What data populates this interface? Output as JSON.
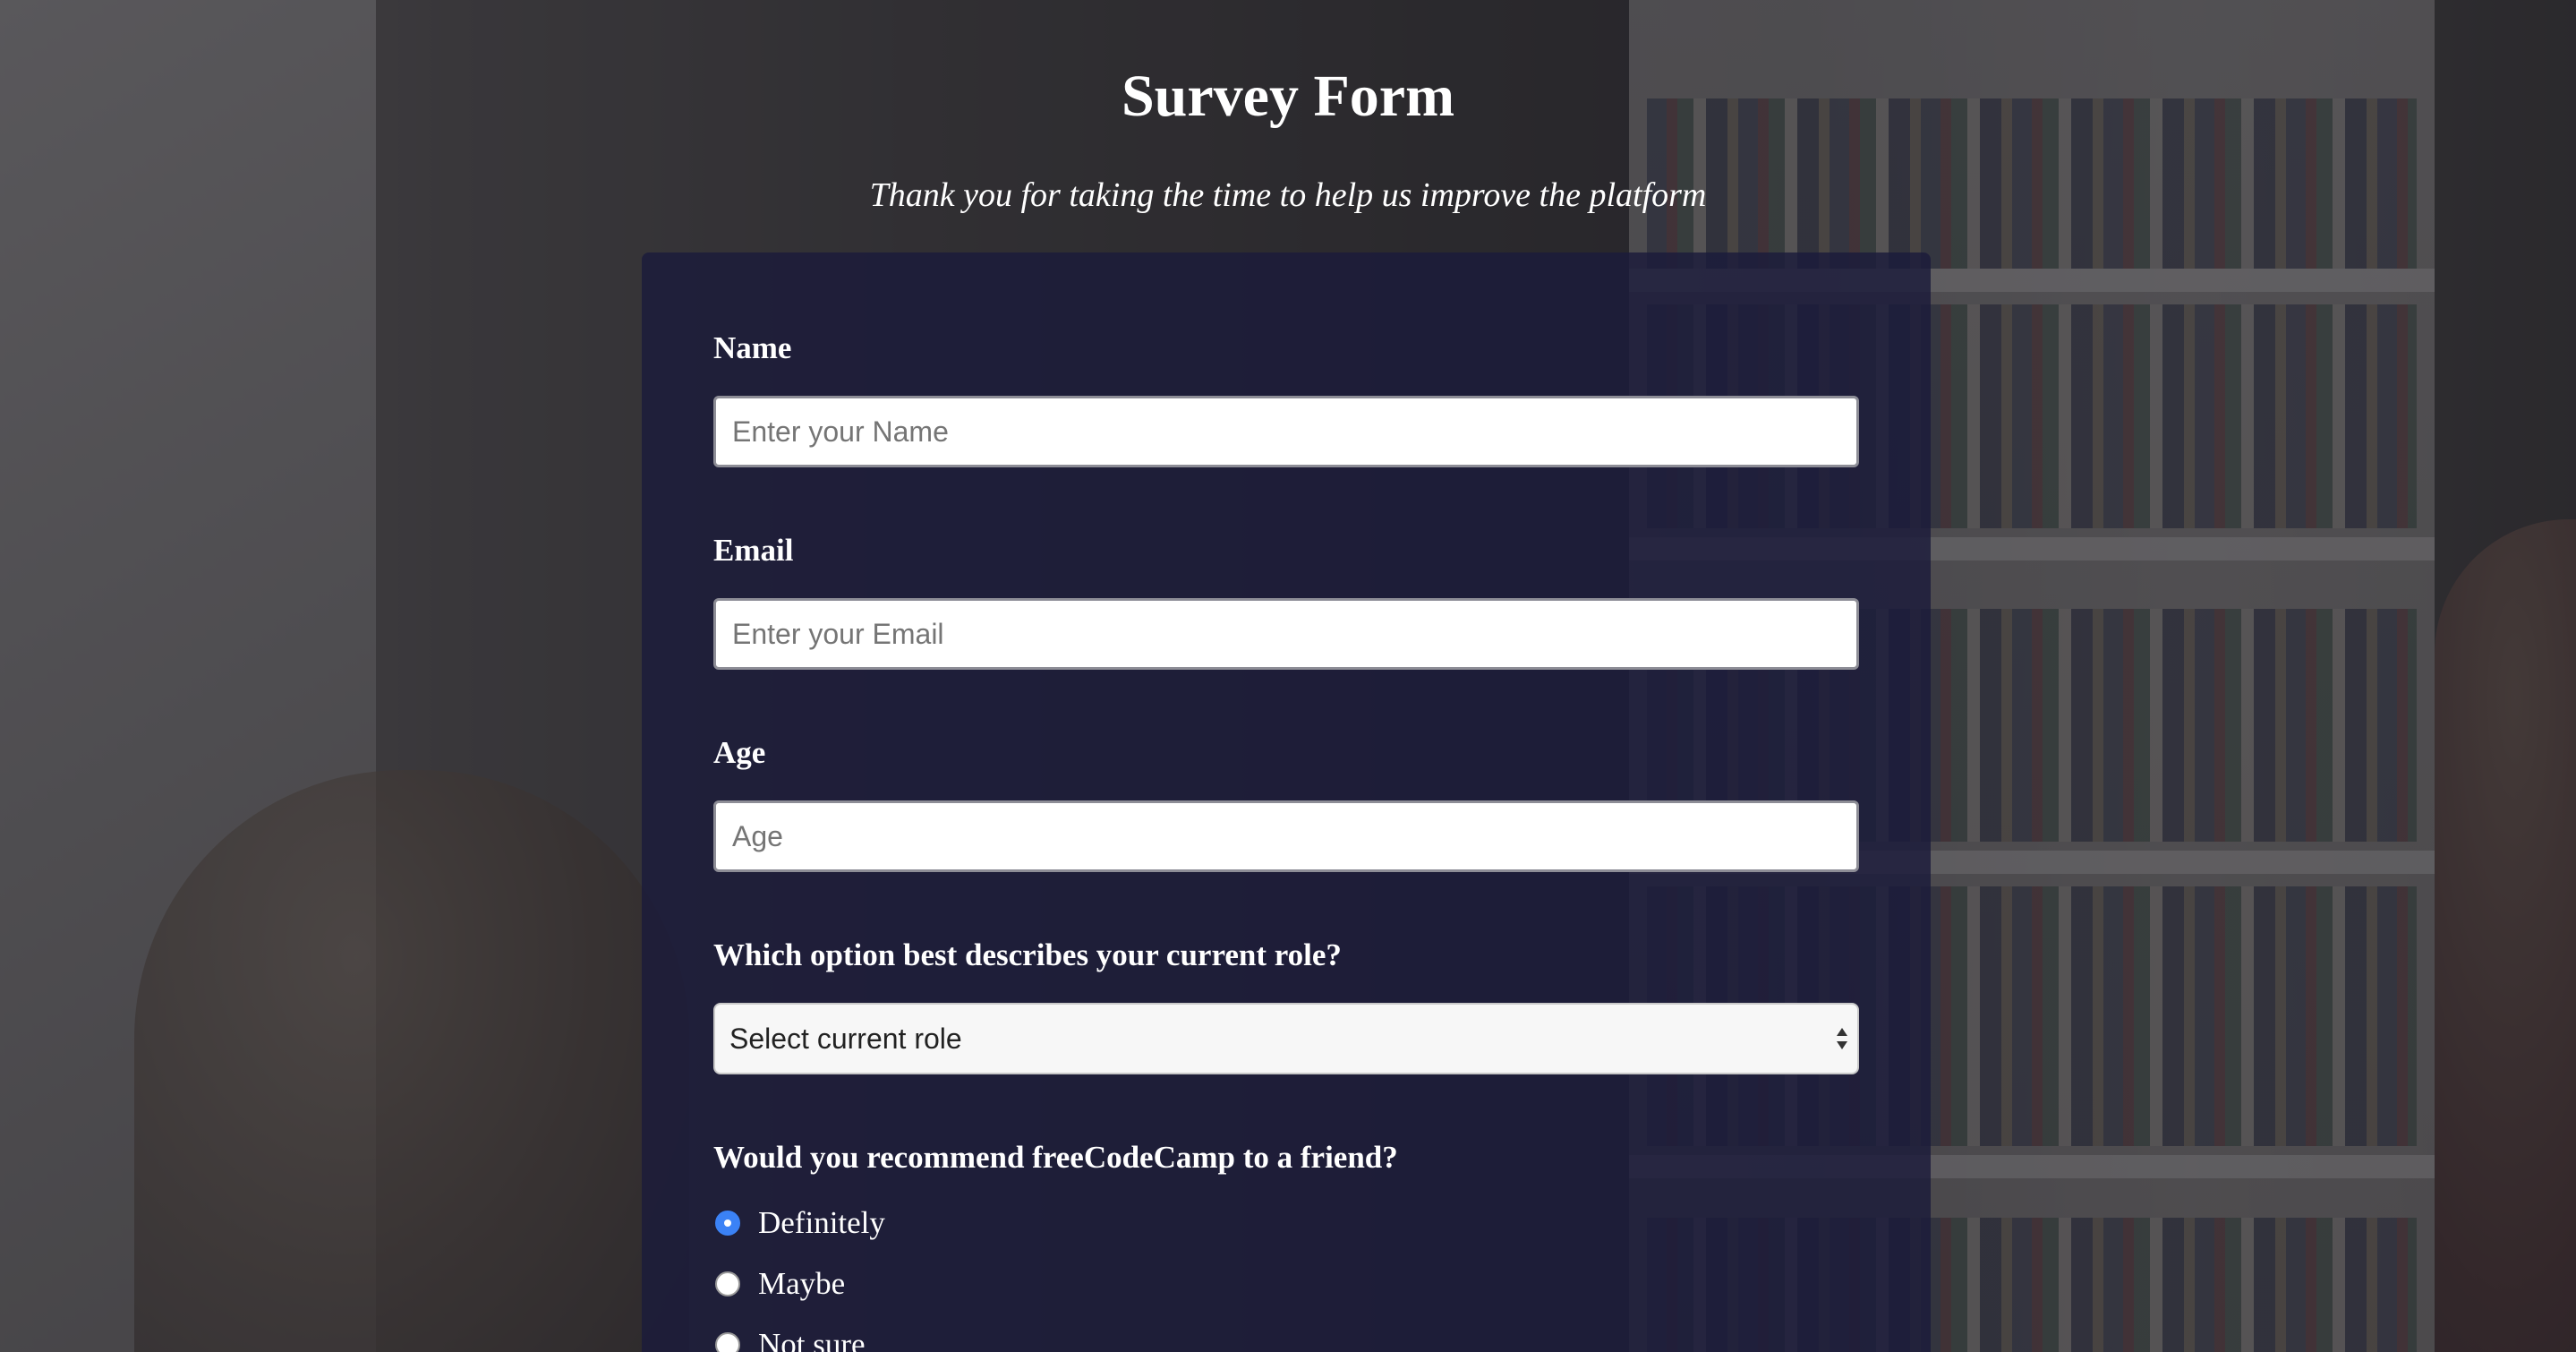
{
  "header": {
    "title": "Survey Form",
    "description": "Thank you for taking the time to help us improve the platform"
  },
  "form": {
    "name": {
      "label": "Name",
      "placeholder": "Enter your Name",
      "value": ""
    },
    "email": {
      "label": "Email",
      "placeholder": "Enter your Email",
      "value": ""
    },
    "age": {
      "label": "Age",
      "placeholder": "Age",
      "value": ""
    },
    "role": {
      "label": "Which option best describes your current role?",
      "selected": "Select current role"
    },
    "recommend": {
      "label": "Would you recommend freeCodeCamp to a friend?",
      "options": [
        {
          "label": "Definitely",
          "checked": true
        },
        {
          "label": "Maybe",
          "checked": false
        },
        {
          "label": "Not sure",
          "checked": false
        }
      ]
    }
  },
  "colors": {
    "card_background": "#1b1b3b",
    "radio_accent": "#3b82f6",
    "text": "#ffffff"
  },
  "icons": {
    "select_arrows": "up-down-chevron-icon"
  }
}
